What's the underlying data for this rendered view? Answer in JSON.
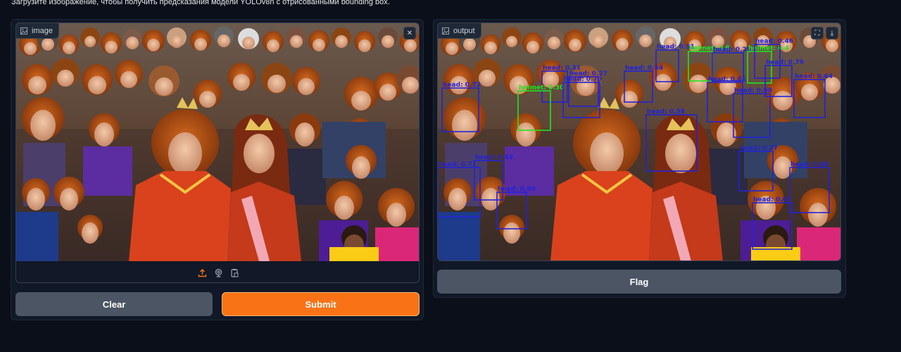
{
  "description": "Загрузите изображение, чтобы получить предсказания модели YOLOv8n с отрисованными bounding box.",
  "input": {
    "label": "image",
    "label_icon": "image-icon",
    "close_icon": "close-icon",
    "sources": [
      "upload-icon",
      "webcam-icon",
      "clipboard-icon"
    ]
  },
  "output": {
    "label": "output",
    "label_icon": "image-icon",
    "actions": [
      "fullscreen-icon",
      "download-icon"
    ]
  },
  "buttons": {
    "clear": "Clear",
    "submit": "Submit",
    "flag": "Flag"
  },
  "colors": {
    "accent": "#f97316",
    "head_box": "#2323d6",
    "helmet_box": "#1ee61e"
  },
  "detections": [
    {
      "label": "head: 0.51"
    },
    {
      "label": "helmet: 0.9"
    },
    {
      "label": "head: 0.28"
    },
    {
      "label": "helmet: 0.4"
    },
    {
      "label": "head: 0.46"
    },
    {
      "label": "head: 0.31"
    },
    {
      "label": "head: 0.27"
    },
    {
      "label": "head: 0.54"
    },
    {
      "label": "head: 0.79"
    },
    {
      "label": "head: 0.72"
    },
    {
      "label": "helmet: 0.30"
    },
    {
      "label": "head: 0.70"
    },
    {
      "label": "head: 0.61"
    },
    {
      "label": "head: 0.64"
    },
    {
      "label": "head: 0.58"
    },
    {
      "label": "head: 0.37"
    },
    {
      "label": "head: 0.71"
    },
    {
      "label": "head: 0.48"
    },
    {
      "label": "head: 0.80"
    },
    {
      "label": "head: 0.67"
    },
    {
      "label": "head: 0.86"
    },
    {
      "label": "head: 0.68"
    }
  ]
}
